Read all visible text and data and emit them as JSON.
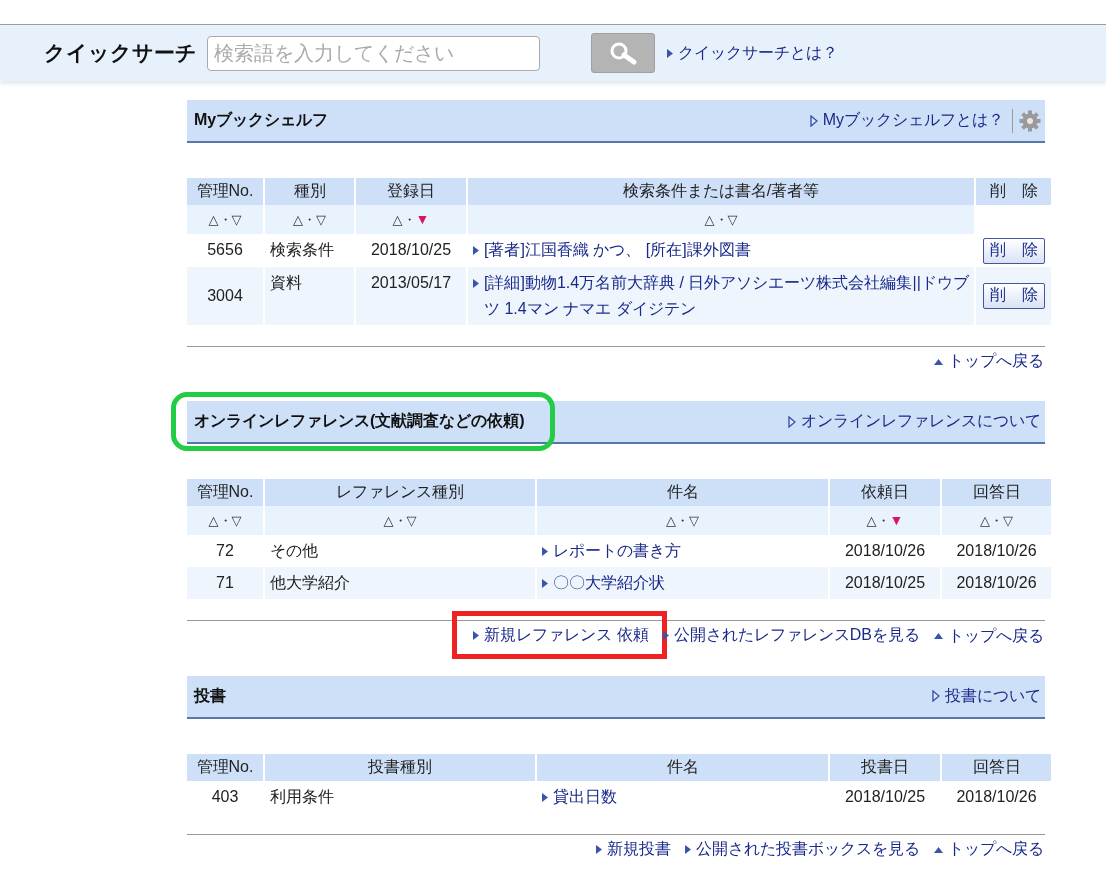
{
  "quick_search": {
    "title": "クイックサーチ",
    "placeholder": "検索語を入力してください",
    "about_link": "クイックサーチとは？"
  },
  "sections": [
    {
      "title": "Myブックシェルフ",
      "about_link": "Myブックシェルフとは？",
      "has_settings": true,
      "table": {
        "kind": "bookshelf",
        "columns": [
          {
            "label": "管理No."
          },
          {
            "label": "種別"
          },
          {
            "label": "登録日"
          },
          {
            "label": "検索条件または書名/著者等"
          },
          {
            "label": "削　除"
          }
        ],
        "sort_row": [
          {
            "up": "△",
            "sep": "・",
            "down": "▽",
            "down_selected": false
          },
          {
            "up": "△",
            "sep": "・",
            "down": "▽",
            "down_selected": false
          },
          {
            "up": "△",
            "sep": "・",
            "down": "▼",
            "down_selected": true
          },
          {
            "up": "△",
            "sep": "・",
            "down": "▽",
            "down_selected": false
          }
        ],
        "rows": [
          {
            "cells": [
              {
                "kind": "num",
                "text": "5656"
              },
              {
                "kind": "text",
                "text": "検索条件"
              },
              {
                "kind": "num",
                "text": "2018/10/25"
              },
              {
                "kind": "link",
                "text": "[著者]江国香織 かつ、 [所在]課外図書"
              },
              {
                "kind": "button",
                "text": "削　除"
              }
            ]
          },
          {
            "cells": [
              {
                "kind": "num",
                "text": "3004"
              },
              {
                "kind": "text",
                "text": "資料"
              },
              {
                "kind": "date",
                "text": "2013/05/17"
              },
              {
                "kind": "link",
                "text": "[詳細]動物1.4万名前大辞典 / 日外アソシエーツ株式会社編集||ドウブツ 1.4マン ナマエ ダイジテン"
              },
              {
                "kind": "button",
                "text": "削　除"
              }
            ]
          }
        ]
      },
      "footer_links": [
        {
          "kind": "top",
          "text": "トップへ戻る"
        }
      ]
    },
    {
      "title": "オンラインレファレンス(文献調査などの依頼)",
      "title_highlighted": true,
      "about_link": "オンラインレファレンスについて",
      "has_settings": false,
      "table": {
        "kind": "requests",
        "columns": [
          {
            "label": "管理No."
          },
          {
            "label": "レファレンス種別"
          },
          {
            "label": "件名"
          },
          {
            "label": "依頼日"
          },
          {
            "label": "回答日"
          }
        ],
        "sort_row": [
          {
            "up": "△",
            "sep": "・",
            "down": "▽",
            "down_selected": false
          },
          {
            "up": "△",
            "sep": "・",
            "down": "▽",
            "down_selected": false
          },
          {
            "up": "△",
            "sep": "・",
            "down": "▽",
            "down_selected": false
          },
          {
            "up": "△",
            "sep": "・",
            "down": "▼",
            "down_selected": true
          },
          {
            "up": "△",
            "sep": "・",
            "down": "▽",
            "down_selected": false
          }
        ],
        "rows": [
          {
            "cells": [
              {
                "kind": "num",
                "text": "72"
              },
              {
                "kind": "text",
                "text": "その他"
              },
              {
                "kind": "link",
                "text": "レポートの書き方"
              },
              {
                "kind": "num",
                "text": "2018/10/26"
              },
              {
                "kind": "num",
                "text": "2018/10/26"
              }
            ]
          },
          {
            "cells": [
              {
                "kind": "num",
                "text": "71"
              },
              {
                "kind": "text",
                "text": "他大学紹介"
              },
              {
                "kind": "link",
                "text": "〇〇大学紹介状"
              },
              {
                "kind": "num",
                "text": "2018/10/25"
              },
              {
                "kind": "num",
                "text": "2018/10/26"
              }
            ]
          }
        ]
      },
      "footer_links": [
        {
          "kind": "link",
          "text": "新規レファレンス 依頼",
          "highlighted": true
        },
        {
          "kind": "link",
          "text": "公開されたレファレンスDBを見る"
        },
        {
          "kind": "top",
          "text": "トップへ戻る"
        }
      ]
    },
    {
      "title": "投書",
      "about_link": "投書について",
      "has_settings": false,
      "table": {
        "kind": "requests",
        "columns": [
          {
            "label": "管理No."
          },
          {
            "label": "投書種別"
          },
          {
            "label": "件名"
          },
          {
            "label": "投書日"
          },
          {
            "label": "回答日"
          }
        ],
        "rows": [
          {
            "cells": [
              {
                "kind": "num",
                "text": "403"
              },
              {
                "kind": "text",
                "text": "利用条件"
              },
              {
                "kind": "link",
                "text": "貸出日数"
              },
              {
                "kind": "num",
                "text": "2018/10/25"
              },
              {
                "kind": "num",
                "text": "2018/10/26"
              }
            ]
          }
        ]
      },
      "footer_links": [
        {
          "kind": "link",
          "text": "新規投書"
        },
        {
          "kind": "link",
          "text": "公開された投書ボックスを見る"
        },
        {
          "kind": "top",
          "text": "トップへ戻る"
        }
      ]
    }
  ]
}
